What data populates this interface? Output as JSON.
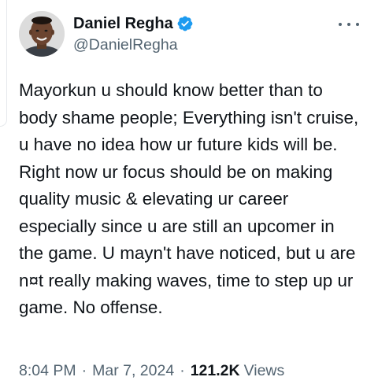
{
  "author": {
    "display_name": "Daniel Regha",
    "handle": "@DanielRegha",
    "verified": true,
    "verified_color": "#1d9bf0"
  },
  "tweet": {
    "text": "Mayorkun u should know better than to body shame people; Everything isn't cruise, u have no idea how ur future kids will be. Right now ur focus should be on making quality music & elevating ur career especially since u are still an upcomer in the game. U mayn't have noticed, but u are n¤t really making waves, time to step up ur game. No offense."
  },
  "meta": {
    "time": "8:04 PM",
    "separator": "·",
    "date": "Mar 7, 2024",
    "views_count": "121.2K",
    "views_label": "Views"
  },
  "icons": {
    "more": "more-options-icon",
    "verified": "verified-badge-icon"
  },
  "colors": {
    "text_primary": "#0f1419",
    "text_secondary": "#536471",
    "background": "#ffffff"
  }
}
